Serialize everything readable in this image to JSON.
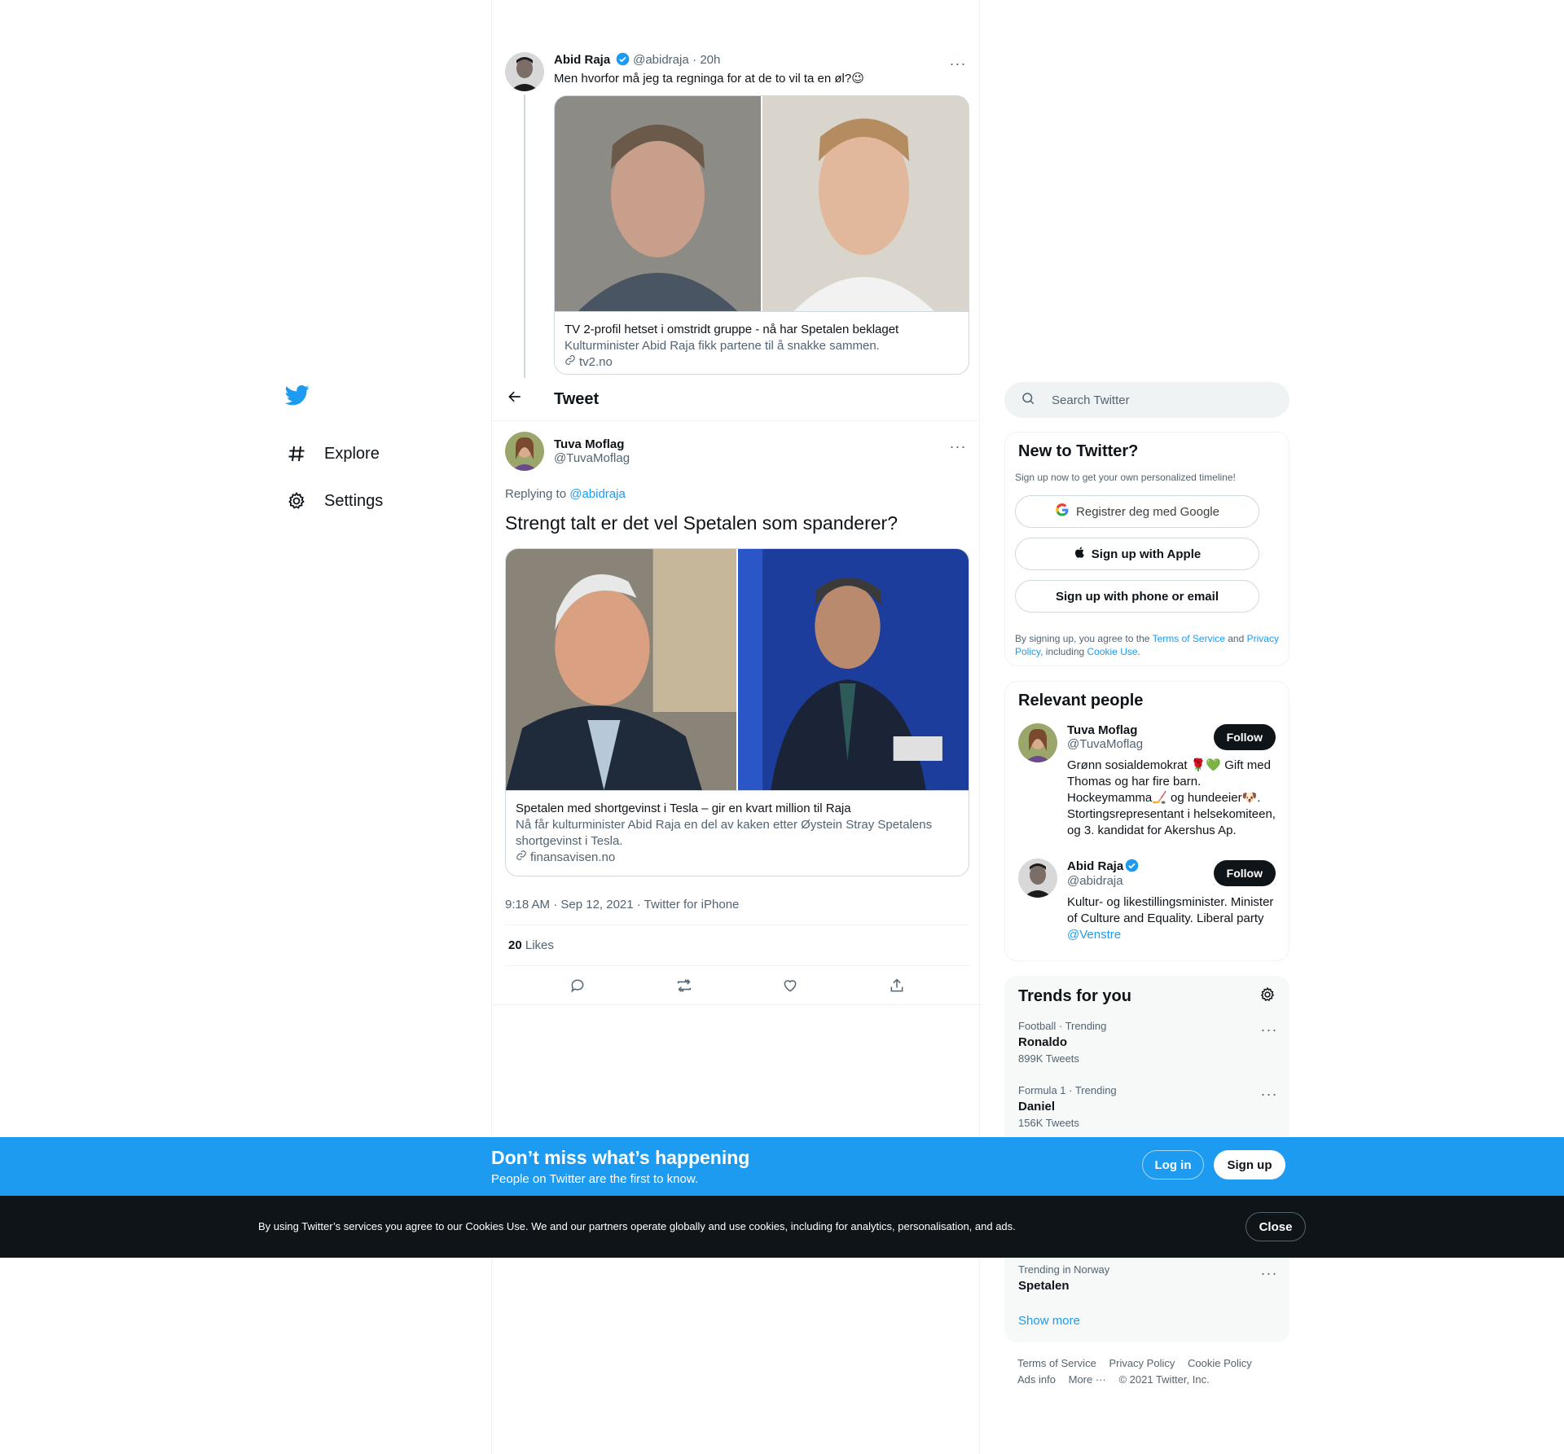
{
  "nav": {
    "items": [
      {
        "label": "Explore",
        "icon": "hashtag-icon"
      },
      {
        "label": "Settings",
        "icon": "gear-icon"
      }
    ]
  },
  "header": {
    "title": "Tweet"
  },
  "parent_tweet": {
    "name": "Abid Raja",
    "handle": "@abidraja",
    "time": "· 20h",
    "text": "Men hvorfor må jeg ta regninga for at de to vil ta en øl?😉",
    "card": {
      "title": "TV 2-profil hetset i omstridt gruppe - nå har Spetalen beklaget",
      "description": "Kulturminister Abid Raja fikk partene til å snakke sammen.",
      "domain": "tv2.no"
    }
  },
  "focus_tweet": {
    "name": "Tuva Moflag",
    "handle": "@TuvaMoflag",
    "replying_prefix": "Replying to ",
    "replying_to": "@abidraja",
    "text": "Strengt talt er det vel Spetalen som spanderer?",
    "card": {
      "title": "Spetalen med shortgevinst i Tesla – gir en kvart million til Raja",
      "description": "Nå får kulturminister Abid Raja en del av kaken etter Øystein Stray Spetalens shortgevinst i Tesla.",
      "domain": "finansavisen.no"
    },
    "timestamp": "9:18 AM · Sep 12, 2021 · Twitter for iPhone",
    "likes_count": "20",
    "likes_label": " Likes"
  },
  "search": {
    "placeholder": "Search Twitter"
  },
  "new_to_twitter": {
    "title": "New to Twitter?",
    "subtitle": "Sign up now to get your own personalized timeline!",
    "google": "Registrer deg med Google",
    "apple": "Sign up with Apple",
    "phone": "Sign up with phone or email",
    "legal_1": "By signing up, you agree to the ",
    "tos": "Terms of Service",
    "legal_2": " and ",
    "privacy": "Privacy Policy",
    "legal_3": ", including ",
    "cookie": "Cookie Use",
    "legal_4": "."
  },
  "relevant_people": {
    "title": "Relevant people",
    "follow_label": "Follow",
    "people": [
      {
        "name": "Tuva Moflag",
        "handle": "@TuvaMoflag",
        "bio": "Grønn sosialdemokrat 🌹💚 Gift med Thomas og har fire barn. Hockeymamma🏒 og hundeeier🐶. Stortingsrepresentant i helsekomiteen, og 3. kandidat for Akershus Ap."
      },
      {
        "name": "Abid Raja",
        "handle": "@abidraja",
        "bio": "Kultur- og likestillingsminister. Minister of Culture and Equality. Liberal party ",
        "bio_link": "@Venstre"
      }
    ]
  },
  "trends": {
    "title": "Trends for you",
    "items": [
      {
        "context": "Football · Trending",
        "name": "Ronaldo",
        "count": "899K Tweets"
      },
      {
        "context": "Formula 1 · Trending",
        "name": "Daniel",
        "count": "156K Tweets"
      },
      {
        "context": "Trending in Norway",
        "name": "Spetalen",
        "count": ""
      }
    ],
    "show_more": "Show more"
  },
  "footer": {
    "links_row1": [
      "Terms of Service",
      "Privacy Policy",
      "Cookie Policy"
    ],
    "links_row2": [
      "Ads info",
      "More ···",
      "© 2021 Twitter, Inc."
    ]
  },
  "bluebar": {
    "heading": "Don’t miss what’s happening",
    "sub": "People on Twitter are the first to know.",
    "login": "Log in",
    "signup": "Sign up"
  },
  "cookiebar": {
    "text": "By using Twitter’s services you agree to our Cookies Use. We and our partners operate globally and use cookies, including for analytics, personalisation, and ads.",
    "close": "Close"
  },
  "colors": {
    "accent": "#1d9bf0",
    "text": "#0f1419",
    "muted": "#536471"
  }
}
